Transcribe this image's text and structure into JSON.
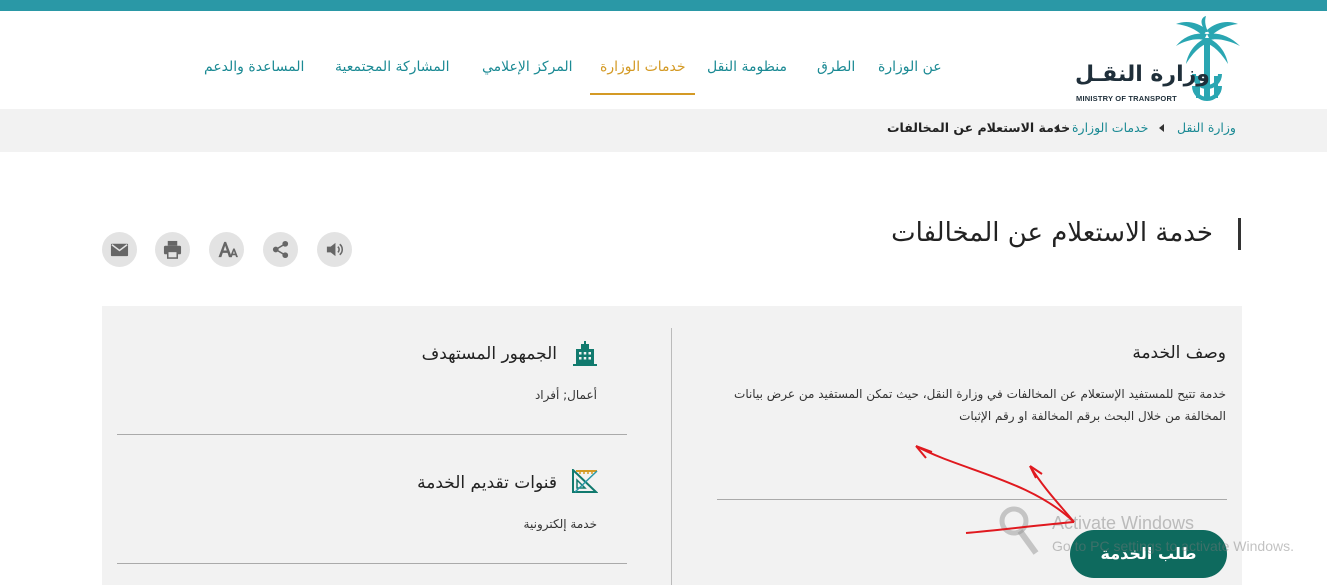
{
  "brand": {
    "name_ar": "وزارة النقـل",
    "name_en": "MINISTRY OF TRANSPORT"
  },
  "nav": [
    {
      "label": "عن الوزارة",
      "active": false
    },
    {
      "label": "الطرق",
      "active": false
    },
    {
      "label": "منظومة النقل",
      "active": false
    },
    {
      "label": "خدمات الوزارة",
      "active": true
    },
    {
      "label": "المركز الإعلامي",
      "active": false
    },
    {
      "label": "المشاركة المجتمعية",
      "active": false
    },
    {
      "label": "المساعدة والدعم",
      "active": false
    }
  ],
  "breadcrumb": [
    {
      "label": "وزارة النقل"
    },
    {
      "label": "خدمات الوزارة"
    },
    {
      "label": "خدمة الاستعلام عن المخالفات"
    }
  ],
  "page": {
    "title": "خدمة الاستعلام عن المخالفات"
  },
  "tools": [
    {
      "icon": "email-icon"
    },
    {
      "icon": "print-icon"
    },
    {
      "icon": "font-size-icon"
    },
    {
      "icon": "share-icon"
    },
    {
      "icon": "speaker-icon"
    }
  ],
  "description": {
    "title": "وصف الخدمة",
    "text": "خدمة تتيح للمستفيد الإستعلام عن  المخالفات في وزارة النقل، حيث تمكن المستفيد من عرض بيانات المخالفة من خلال البحث برقم المخالفة او رقم الإثبات"
  },
  "audience": {
    "title": "الجمهور المستهدف",
    "value": "أعمال; أفراد",
    "icon": "building-icon"
  },
  "channels": {
    "title": "قنوات تقديم الخدمة",
    "value": "خدمة إلكترونية",
    "icon": "ruler-triangle-icon"
  },
  "cta": {
    "label": "طلب الخدمة"
  },
  "overlay": {
    "line1": "Activate Windows",
    "line2": "Go to PC settings to activate Windows."
  },
  "colors": {
    "teal": "#2a98a6",
    "nav_text": "#1b8a94",
    "active": "#d49a25",
    "cta": "#0e6a5e",
    "annotation": "#e0191f"
  }
}
